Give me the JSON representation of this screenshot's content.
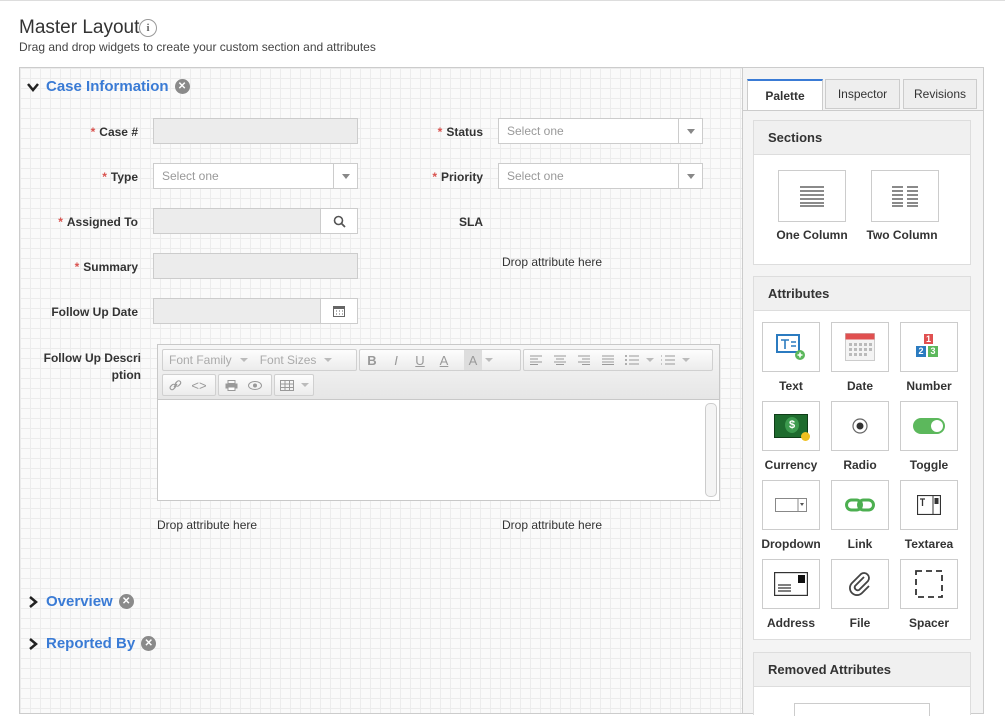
{
  "header": {
    "title": "Master Layout",
    "info_icon_text": "i",
    "subtitle": "Drag and drop widgets to create your custom section and attributes"
  },
  "sections": [
    {
      "title": "Case Information",
      "expanded": true
    },
    {
      "title": "Overview",
      "expanded": false
    },
    {
      "title": "Reported By",
      "expanded": false
    }
  ],
  "form": {
    "case_no_label": "Case #",
    "status_label": "Status",
    "status_placeholder": "Select one",
    "type_label": "Type",
    "type_placeholder": "Select one",
    "priority_label": "Priority",
    "priority_placeholder": "Select one",
    "assigned_to_label": "Assigned To",
    "sla_label": "SLA",
    "summary_label": "Summary",
    "follow_up_date_label": "Follow Up Date",
    "follow_up_desc_label_1": "Follow Up Descri",
    "follow_up_desc_label_2": "ption",
    "required_mark": "*",
    "drop_text": "Drop attribute here"
  },
  "editor": {
    "font_family": "Font Family",
    "font_sizes": "Font Sizes",
    "bold": "B",
    "italic": "I",
    "underline": "U",
    "font_color": "A",
    "bg_color": "A"
  },
  "palette": {
    "tabs": [
      {
        "label": "Palette",
        "active": true
      },
      {
        "label": "Inspector",
        "active": false
      },
      {
        "label": "Revisions",
        "active": false
      }
    ],
    "sections_title": "Sections",
    "sections_items": [
      {
        "label": "One Column",
        "icon": "one-column-icon"
      },
      {
        "label": "Two Column",
        "icon": "two-column-icon"
      }
    ],
    "attributes_title": "Attributes",
    "attributes": [
      {
        "label": "Text",
        "icon": "text-icon"
      },
      {
        "label": "Date",
        "icon": "calendar-icon"
      },
      {
        "label": "Number",
        "icon": "number-icon"
      },
      {
        "label": "Currency",
        "icon": "currency-icon"
      },
      {
        "label": "Radio",
        "icon": "radio-icon"
      },
      {
        "label": "Toggle",
        "icon": "toggle-icon"
      },
      {
        "label": "Dropdown",
        "icon": "dropdown-icon"
      },
      {
        "label": "Link",
        "icon": "link-icon"
      },
      {
        "label": "Textarea",
        "icon": "textarea-icon"
      },
      {
        "label": "Address",
        "icon": "address-icon"
      },
      {
        "label": "File",
        "icon": "paperclip-icon"
      },
      {
        "label": "Spacer",
        "icon": "spacer-icon"
      }
    ],
    "number_icon_digits": [
      "1",
      "2",
      "3"
    ],
    "currency_icon_symbol": "$",
    "removed_title": "Removed Attributes"
  },
  "colors": {
    "accent": "#3a7bd5",
    "required": "#d9534f",
    "toggle_on": "#5cb85c"
  }
}
